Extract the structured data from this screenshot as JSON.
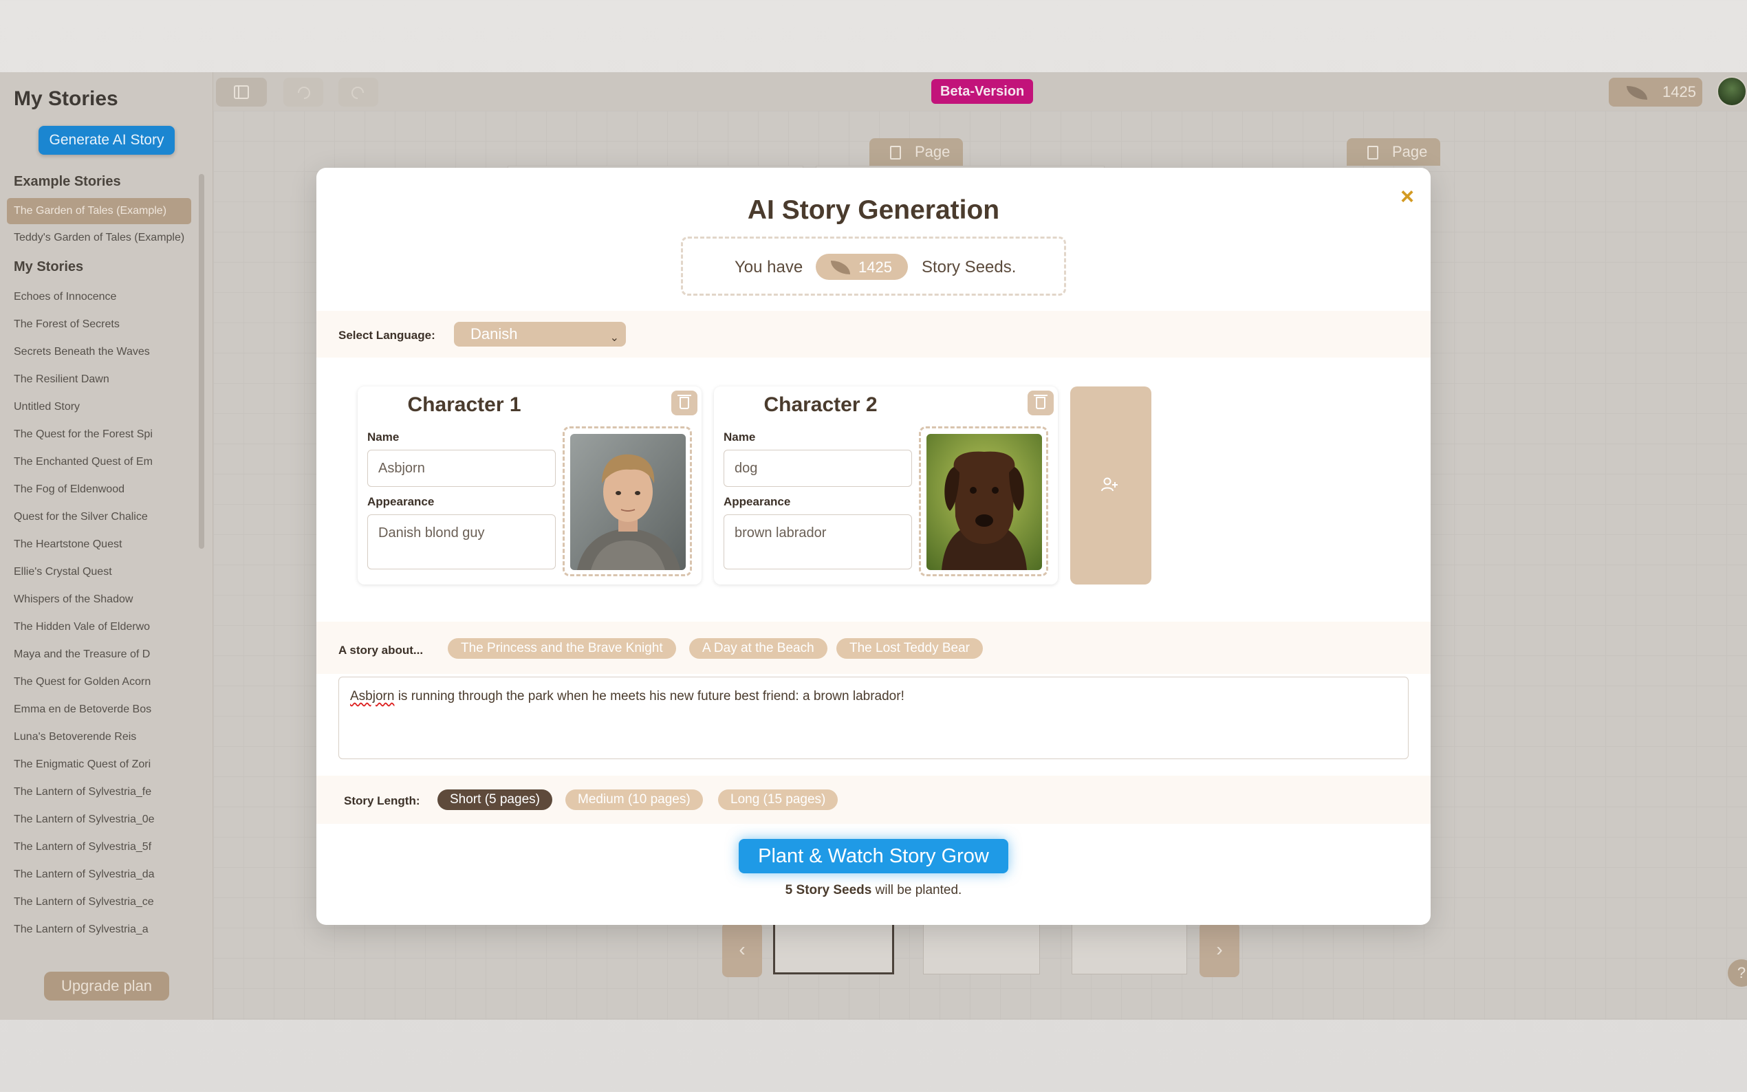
{
  "sidebar": {
    "title": "My Stories",
    "generate_label": "Generate AI Story",
    "example_heading": "Example Stories",
    "examples": [
      "The Garden of Tales (Example)",
      "Teddy's Garden of Tales (Example)"
    ],
    "mine_heading": "My Stories",
    "stories": [
      "Echoes of Innocence",
      "The Forest of Secrets",
      "Secrets Beneath the Waves",
      "The Resilient Dawn",
      "Untitled Story",
      "The Quest for the Forest Spi",
      "The Enchanted Quest of Em",
      "The Fog of Eldenwood",
      "Quest for the Silver Chalice",
      "The Heartstone Quest",
      "Ellie's Crystal Quest",
      "Whispers of the Shadow",
      "The Hidden Vale of Elderwo",
      "Maya and the Treasure of D",
      "The Quest for Golden Acorn",
      "Emma en de Betoverde Bos",
      "Luna's Betoverende Reis",
      "The Enigmatic Quest of Zori",
      "The Lantern of Sylvestria_fe",
      "The Lantern of Sylvestria_0e",
      "The Lantern of Sylvestria_5f",
      "The Lantern of Sylvestria_da",
      "The Lantern of Sylvestria_ce",
      "The Lantern of Sylvestria_a"
    ],
    "upgrade_label": "Upgrade plan"
  },
  "toolbar": {
    "beta_label": "Beta-Version",
    "seeds_count": "1425"
  },
  "canvas": {
    "page_label": "Page",
    "help_label": "?"
  },
  "modal": {
    "title": "AI Story Generation",
    "close_label": "×",
    "seeds_prefix": "You have",
    "seeds_count": "1425",
    "seeds_suffix": "Story Seeds.",
    "language_label": "Select Language:",
    "language_value": "Danish",
    "characters": [
      {
        "title": "Character 1",
        "name_label": "Name",
        "name_value": "Asbjorn",
        "appearance_label": "Appearance",
        "appearance_value": "Danish blond guy"
      },
      {
        "title": "Character 2",
        "name_label": "Name",
        "name_value": "dog",
        "appearance_label": "Appearance",
        "appearance_value": "brown labrador"
      }
    ],
    "story_label": "A story about...",
    "story_suggestions": [
      "The Princess and the Brave Knight",
      "A Day at the Beach",
      "The Lost Teddy Bear"
    ],
    "story_text_first_word": "Asbjorn",
    "story_text_rest": " is running through the park when he meets his new future best friend: a brown labrador!",
    "length_label": "Story Length:",
    "lengths": [
      "Short (5 pages)",
      "Medium (10 pages)",
      "Long (15 pages)"
    ],
    "plant_label": "Plant & Watch Story Grow",
    "plant_note_bold": "5 Story Seeds",
    "plant_note_rest": " will be planted."
  }
}
